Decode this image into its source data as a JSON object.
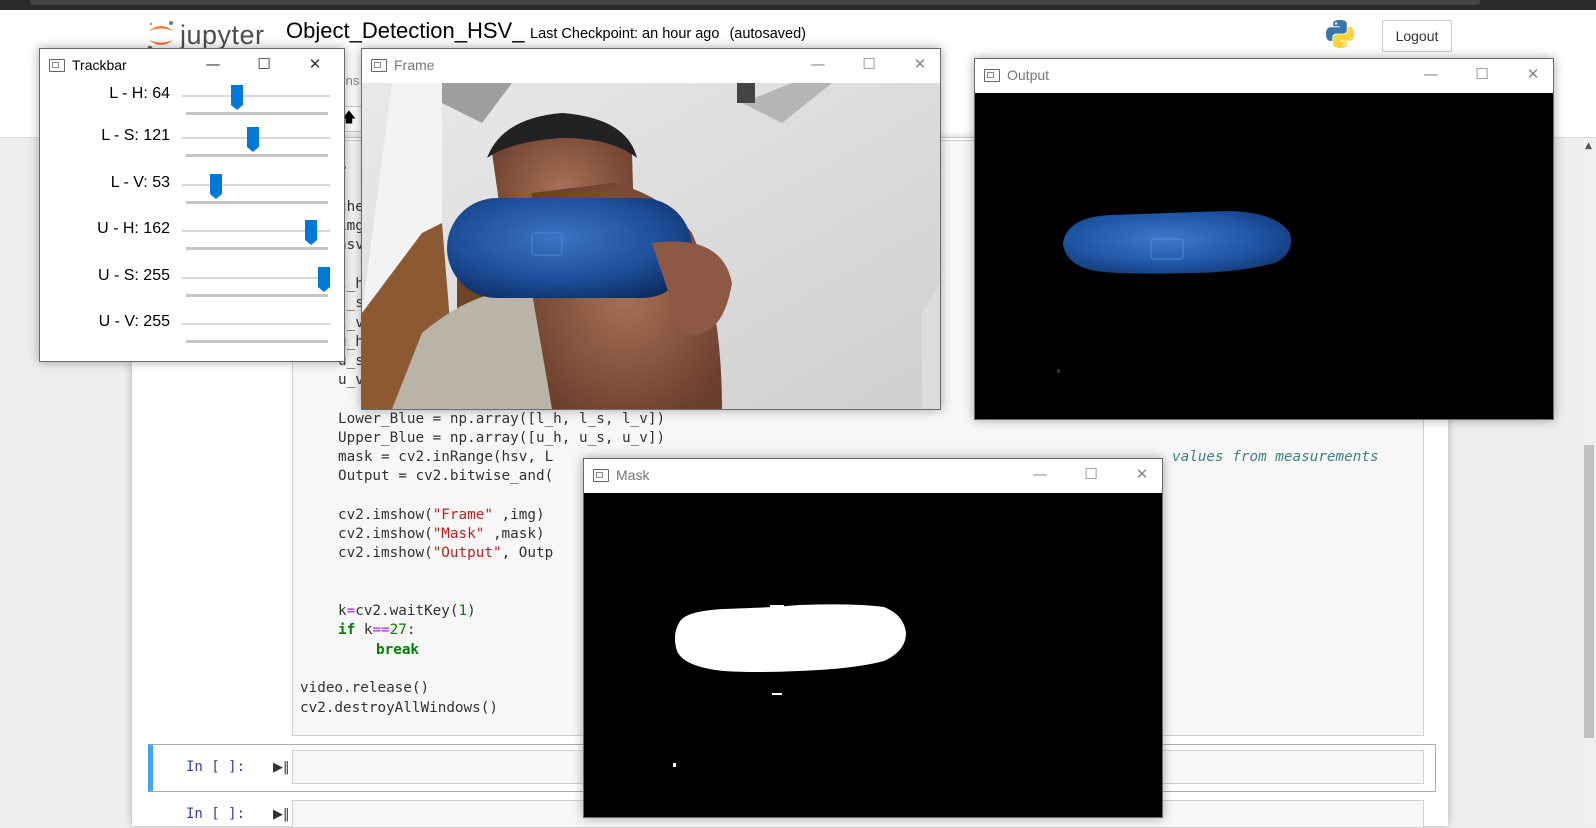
{
  "jupyter": {
    "logo_text": "jupyter",
    "notebook_name": "Object_Detection_HSV_",
    "checkpoint": "Last Checkpoint: an hour ago",
    "autosaved": "(autosaved)",
    "logout": "Logout",
    "menu_partial": "Ins"
  },
  "code": {
    "partial_lines": [
      "che",
      "img",
      "hsv",
      "l_h",
      "l_s",
      "l_v",
      "u_h",
      "u_s",
      "u_v"
    ],
    "partial_first": "e",
    "lines": {
      "lower": "Lower_Blue = np.array([l_h, l_s, l_v])",
      "upper": "Upper_Blue = np.array([u_h, u_s, u_v])",
      "mask": "mask = cv2.inRange(hsv, L",
      "mask_comment": "values from measurements",
      "output": "Output = cv2.bitwise_and(",
      "show_frame_a": "cv2.imshow(",
      "show_frame_s": "\"Frame\"",
      "show_frame_b": " ,img)",
      "show_mask_a": "cv2.imshow(",
      "show_mask_s": "\"Mask\"",
      "show_mask_b": " ,mask)",
      "show_out_a": "cv2.imshow(",
      "show_out_s": "\"Output\"",
      "show_out_b": ", Outp",
      "wait_a": "k",
      "wait_b": "=",
      "wait_c": "cv2.waitKey(",
      "wait_d": "1",
      "wait_e": ")",
      "if_kw": "if",
      "if_b": " k",
      "if_op": "==",
      "if_num": "27",
      "if_colon": ":",
      "break_kw": "break",
      "release": "video.release()",
      "destroy": "cv2.destroyAllWindows()"
    },
    "prompt_empty": "In [ ]:"
  },
  "windows": {
    "trackbar": {
      "title": "Trackbar"
    },
    "frame": {
      "title": "Frame"
    },
    "output": {
      "title": "Output"
    },
    "mask": {
      "title": "Mask"
    }
  },
  "trackbars": [
    {
      "label": "L - H: 64",
      "value": 64,
      "max": 179
    },
    {
      "label": "L - S: 121",
      "value": 121,
      "max": 255
    },
    {
      "label": "L - V: 53",
      "value": 53,
      "max": 255
    },
    {
      "label": "U - H: 162",
      "value": 162,
      "max": 179
    },
    {
      "label": "U - S: 255",
      "value": 255,
      "max": 255
    },
    {
      "label": "U - V: 255",
      "value": 255,
      "max": 255
    }
  ],
  "colors": {
    "accent": "#0078d7",
    "cell_selected": "#42a5f5",
    "prompt": "#303f9f"
  }
}
